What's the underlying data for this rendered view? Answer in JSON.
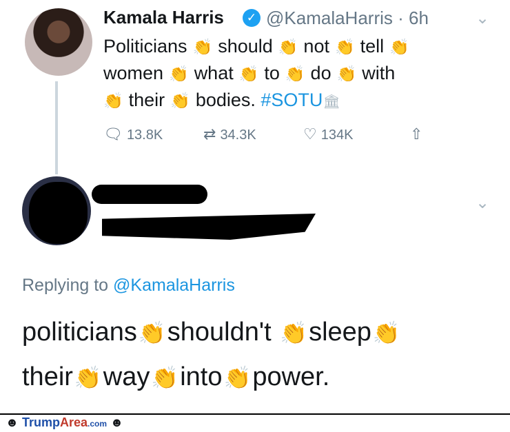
{
  "tweet": {
    "author_name": "Kamala Harris",
    "verified_icon": "verified-badge-icon",
    "handle_time": "@KamalaHarris · 6h",
    "words": [
      "Politicians",
      "should",
      "not",
      "tell",
      "women",
      "what",
      "to",
      "do",
      "with",
      "their",
      "bodies."
    ],
    "hashtag": "#SOTU",
    "clap_emoji": "👏",
    "capitol_icon": "🏛",
    "menu_icon": "⌄",
    "stats": {
      "replies": "13.8K",
      "retweets": "34.3K",
      "likes": "134K"
    }
  },
  "reply": {
    "menu_icon": "⌄",
    "replying_prefix": "Replying to",
    "replying_mention": "@KamalaHarris",
    "words": [
      "politicians",
      "shouldn't",
      "sleep",
      "their",
      "way",
      "into",
      "power."
    ]
  },
  "footer": {
    "brand_trump": "Trump",
    "brand_area": "Area",
    "brand_com": ".com"
  },
  "colors": {
    "link": "#1b95e0",
    "muted": "#657786",
    "verified": "#1da1f2"
  }
}
